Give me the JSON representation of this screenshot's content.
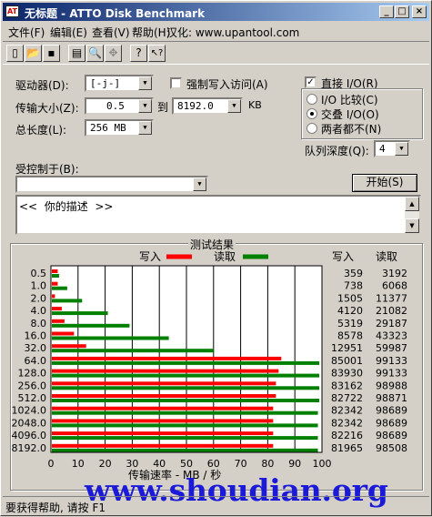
{
  "window": {
    "title": "无标题 - ATTO Disk Benchmark",
    "title_icon": "atto-app-icon",
    "controls": [
      "_",
      "□",
      "×"
    ]
  },
  "menu": [
    {
      "label": "文件(F)"
    },
    {
      "label": "编辑(E)"
    },
    {
      "label": "查看(V)"
    },
    {
      "label": "帮助(H)"
    },
    {
      "label": "汉化: www.upantool.com"
    }
  ],
  "toolbar": {
    "icons": [
      "new-file-icon",
      "open-folder-icon",
      "save-icon",
      "print-icon",
      "print-preview-icon",
      "move-icon",
      "help-icon",
      "context-help-icon"
    ],
    "glyphs": [
      "▯",
      "📂",
      "▪",
      "▤",
      "🔍",
      "✥",
      "?",
      "↖?"
    ]
  },
  "settings": {
    "drive_label": "驱动器(D):",
    "drive_value": "[-j-]",
    "force_write_label": "强制写入访问(A)",
    "force_write_checked": false,
    "transfer_label": "传输大小(Z):",
    "transfer_from": "0.5",
    "to_label": "到",
    "transfer_to": "8192.0",
    "kb_label": "KB",
    "total_label": "总长度(L):",
    "total_value": "256 MB",
    "direct_io_label": "直接 I/O(R)",
    "direct_io_checked": true,
    "radio_options": [
      {
        "label": "I/O 比较(C)",
        "selected": false
      },
      {
        "label": "交叠 I/O(O)",
        "selected": true
      },
      {
        "label": "两者都不(N)",
        "selected": false
      }
    ],
    "queue_label": "队列深度(Q):",
    "queue_value": "4",
    "controlled_label": "受控制于(B):",
    "controlled_value": "",
    "start_button": "开始(S)",
    "description": "<<  你的描述  >>"
  },
  "results": {
    "group_title": "测试结果",
    "legend_write": "写入",
    "legend_read": "读取",
    "col_write": "写入",
    "col_read": "读取",
    "write_color": "#ff0000",
    "read_color": "#008000"
  },
  "chart_data": {
    "type": "bar",
    "orientation": "horizontal",
    "xlabel": "传输速率 - MB / 秒",
    "xlim": [
      0,
      100
    ],
    "xticks": [
      "0",
      "10",
      "20",
      "30",
      "40",
      "50",
      "60",
      "70",
      "80",
      "90",
      "100"
    ],
    "categories": [
      "0.5",
      "1.0",
      "2.0",
      "4.0",
      "8.0",
      "16.0",
      "32.0",
      "64.0",
      "128.0",
      "256.0",
      "512.0",
      "1024.0",
      "2048.0",
      "4096.0",
      "8192.0"
    ],
    "series": [
      {
        "name": "写入",
        "values": [
          2.5,
          2.5,
          1.5,
          4,
          5,
          8.5,
          13,
          85,
          84,
          83,
          83,
          82,
          82,
          82,
          82
        ],
        "labels": [
          "359",
          "738",
          "1505",
          "4120",
          "5319",
          "8578",
          "12951",
          "85001",
          "83930",
          "83162",
          "82722",
          "82342",
          "82342",
          "82216",
          "81965"
        ]
      },
      {
        "name": "读取",
        "values": [
          3,
          6,
          11.5,
          21,
          29,
          43.5,
          60,
          99,
          99,
          99,
          99,
          98.5,
          98.5,
          98.5,
          98.5
        ],
        "labels": [
          "3192",
          "6068",
          "11377",
          "21082",
          "29187",
          "43323",
          "59987",
          "99133",
          "99133",
          "98988",
          "98871",
          "98689",
          "98689",
          "98689",
          "98508"
        ]
      }
    ]
  },
  "statusbar": {
    "text": "要获得帮助, 请按 F1"
  },
  "watermark": {
    "text": "www.shoudian.org"
  }
}
